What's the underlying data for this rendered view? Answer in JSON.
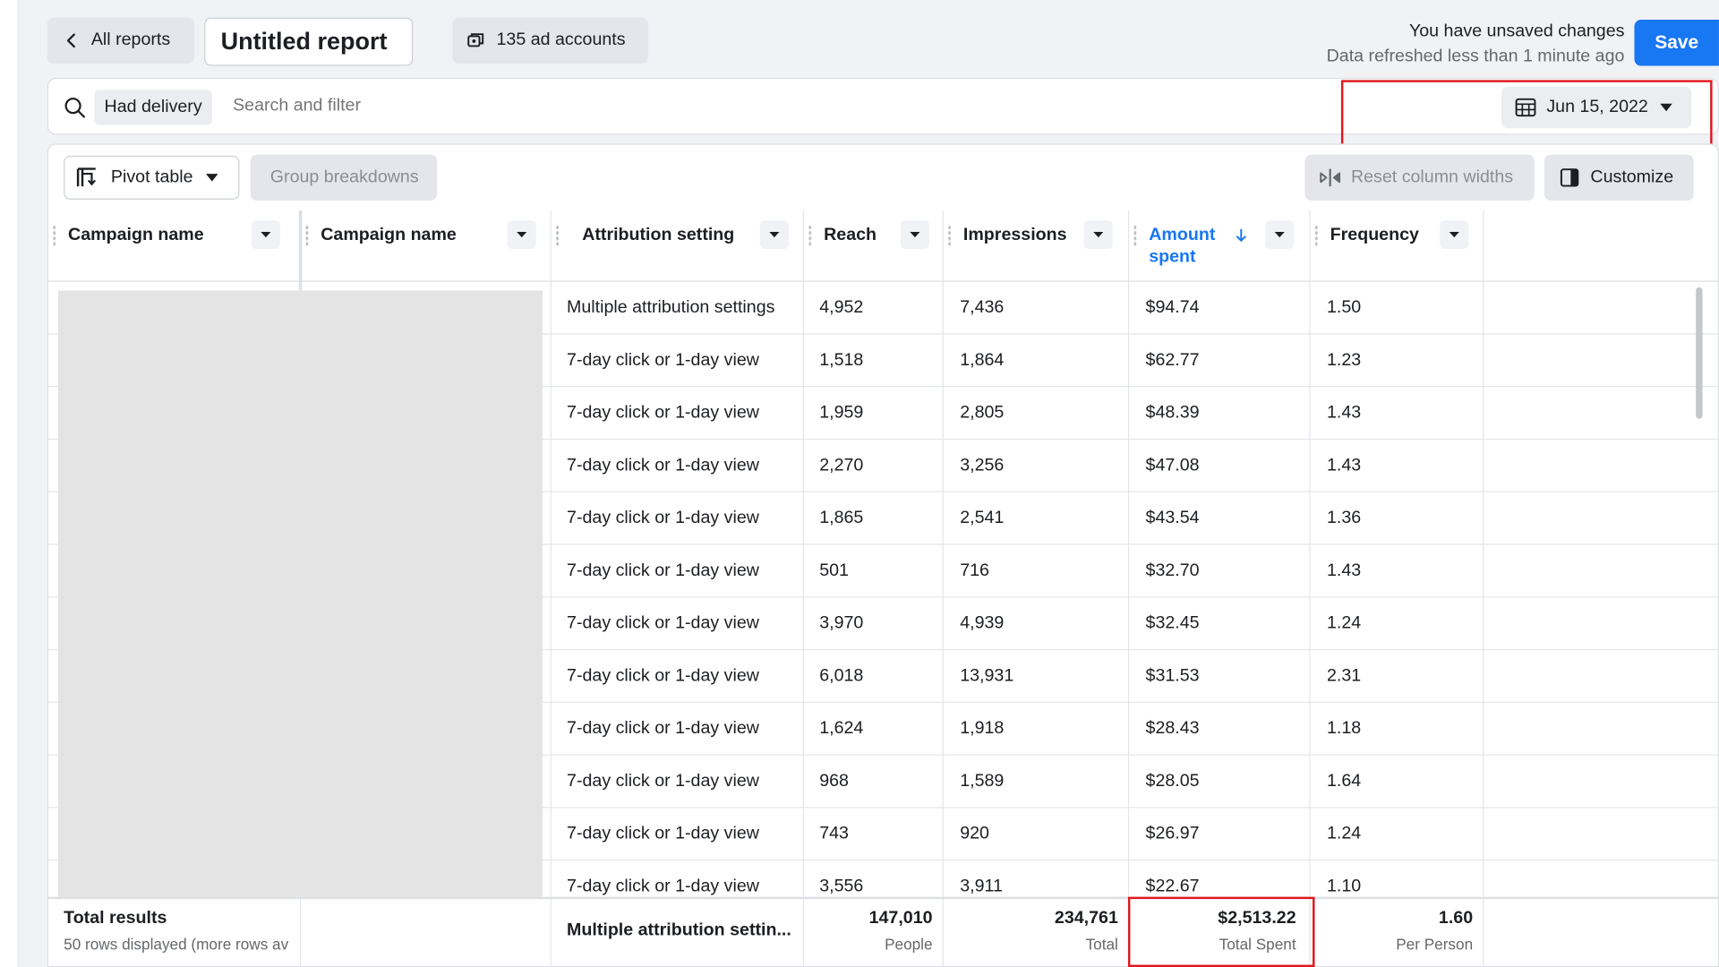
{
  "header": {
    "back_label": "All reports",
    "report_title": "Untitled report",
    "accounts_label": "135 ad accounts",
    "status_line1": "You have unsaved changes",
    "status_line2": "Data refreshed less than 1 minute ago",
    "save_label": "Save"
  },
  "filter": {
    "chip_label": "Had delivery",
    "search_placeholder": "Search and filter",
    "date_label": "Jun 15, 2022"
  },
  "toolbar": {
    "view_label": "Pivot table",
    "group_label": "Group breakdowns",
    "reset_label": "Reset column widths",
    "customize_label": "Customize"
  },
  "columns": {
    "c1": "Campaign name",
    "c2": "Campaign name",
    "c3": "Attribution setting",
    "c4": "Reach",
    "c5": "Impressions",
    "c6": "Amount spent",
    "c7": "Frequency"
  },
  "rows": [
    {
      "attribution": "Multiple attribution settings",
      "reach": "4,952",
      "impressions": "7,436",
      "amount": "$94.74",
      "frequency": "1.50"
    },
    {
      "attribution": "7-day click or 1-day view",
      "reach": "1,518",
      "impressions": "1,864",
      "amount": "$62.77",
      "frequency": "1.23"
    },
    {
      "attribution": "7-day click or 1-day view",
      "reach": "1,959",
      "impressions": "2,805",
      "amount": "$48.39",
      "frequency": "1.43"
    },
    {
      "attribution": "7-day click or 1-day view",
      "reach": "2,270",
      "impressions": "3,256",
      "amount": "$47.08",
      "frequency": "1.43"
    },
    {
      "attribution": "7-day click or 1-day view",
      "reach": "1,865",
      "impressions": "2,541",
      "amount": "$43.54",
      "frequency": "1.36"
    },
    {
      "attribution": "7-day click or 1-day view",
      "reach": "501",
      "impressions": "716",
      "amount": "$32.70",
      "frequency": "1.43"
    },
    {
      "attribution": "7-day click or 1-day view",
      "reach": "3,970",
      "impressions": "4,939",
      "amount": "$32.45",
      "frequency": "1.24"
    },
    {
      "attribution": "7-day click or 1-day view",
      "reach": "6,018",
      "impressions": "13,931",
      "amount": "$31.53",
      "frequency": "2.31"
    },
    {
      "attribution": "7-day click or 1-day view",
      "reach": "1,624",
      "impressions": "1,918",
      "amount": "$28.43",
      "frequency": "1.18"
    },
    {
      "attribution": "7-day click or 1-day view",
      "reach": "968",
      "impressions": "1,589",
      "amount": "$28.05",
      "frequency": "1.64"
    },
    {
      "attribution": "7-day click or 1-day view",
      "reach": "743",
      "impressions": "920",
      "amount": "$26.97",
      "frequency": "1.24"
    },
    {
      "attribution": "7-day click or 1-day view",
      "reach": "3,556",
      "impressions": "3,911",
      "amount": "$22.67",
      "frequency": "1.10"
    }
  ],
  "totals": {
    "label": "Total results",
    "sublabel": "50 rows displayed (more rows av",
    "attribution": "Multiple attribution settin...",
    "reach": "147,010",
    "reach_unit": "People",
    "impressions": "234,761",
    "impressions_unit": "Total",
    "amount": "$2,513.22",
    "amount_unit": "Total Spent",
    "frequency": "1.60",
    "frequency_unit": "Per Person"
  },
  "colors": {
    "accent": "#1877f2",
    "highlight": "#e0181e"
  },
  "icons": [
    "chevron-left-icon",
    "ad-accounts-icon",
    "search-icon",
    "calendar-icon",
    "caret-down-icon",
    "pivot-table-icon",
    "reset-columns-icon",
    "customize-columns-icon",
    "sort-descending-icon"
  ]
}
